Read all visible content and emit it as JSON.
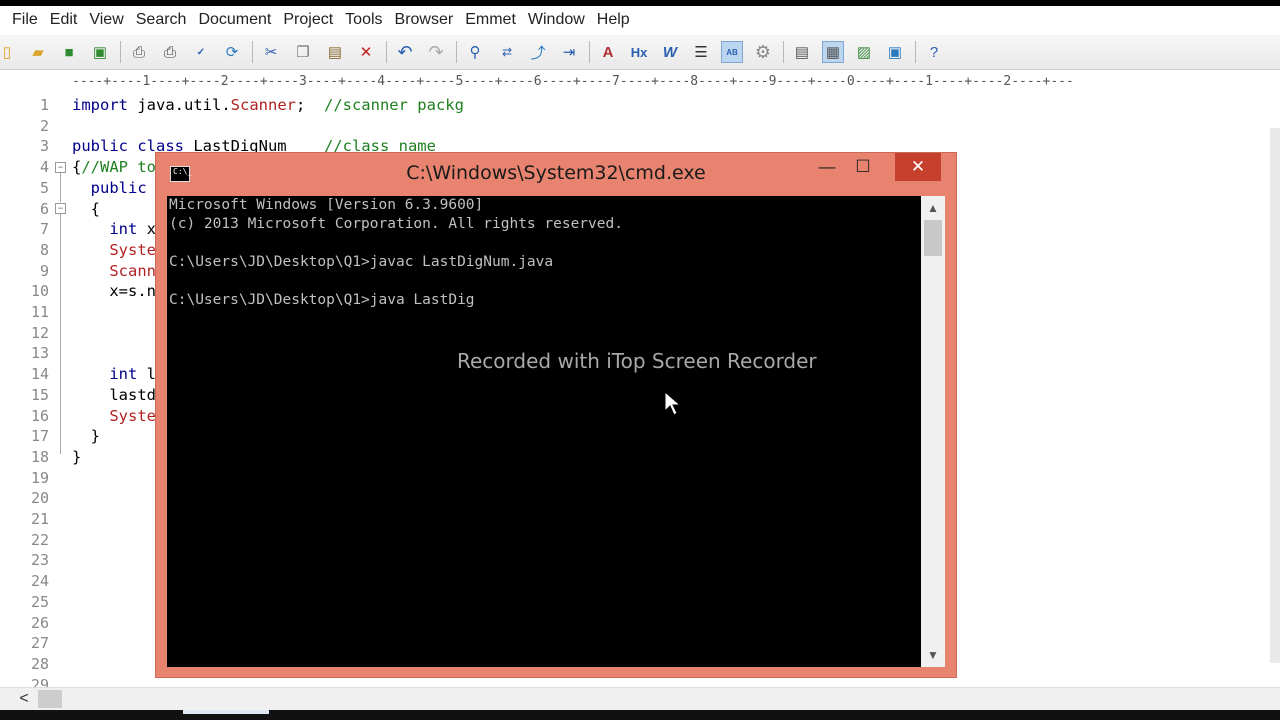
{
  "menu": [
    "File",
    "Edit",
    "View",
    "Search",
    "Document",
    "Project",
    "Tools",
    "Browser",
    "Emmet",
    "Window",
    "Help"
  ],
  "toolbar": {
    "icons": [
      "new-file-icon",
      "open-folder-icon",
      "save-icon",
      "save-all-icon",
      "print-preview-icon",
      "print-icon",
      "spell-check-icon",
      "sync-icon",
      "cut-icon",
      "copy-icon",
      "paste-icon",
      "delete-icon",
      "undo-icon",
      "redo-icon",
      "find-icon",
      "replace-icon",
      "goto-icon",
      "indent-icon",
      "font-icon",
      "hex-icon",
      "word-wrap-icon",
      "align-icon",
      "column-mode-icon",
      "settings-icon",
      "panel-icon",
      "layout-icon",
      "image-icon",
      "export-icon",
      "help-icon"
    ]
  },
  "ruler": "----+----1----+----2----+----3----+----4----+----5----+----6----+----7----+----8----+----9----+----0----+----1----+----2----+---",
  "editor": {
    "line_numbers": [
      "1",
      "2",
      "3",
      "4",
      "5",
      "6",
      "7",
      "8",
      "9",
      "10",
      "11",
      "12",
      "13",
      "14",
      "15",
      "16",
      "17",
      "18",
      "19",
      "20",
      "21",
      "22",
      "23",
      "24",
      "25",
      "26",
      "27",
      "28",
      "29"
    ],
    "code": {
      "l1_kw": "import",
      "l1_text": " java.util.",
      "l1_red": "Scanner",
      "l1_semi": ";  ",
      "l1_cm": "//scanner packg",
      "l3_kw": "public class",
      "l3_text": " LastDigNum    ",
      "l3_cm": "//class name",
      "l4_brace": "{",
      "l4_cm": "//WAP to",
      "l5_kw": "  public",
      "l6_text": "  {",
      "l7_kw": "    int",
      "l7_text": " x",
      "l8_red": "    Syste",
      "l9_red": "    Scann",
      "l10_text": "    x=s.n",
      "l14_kw": "    int",
      "l14_text": " l",
      "l15_text": "    lastd",
      "l16_red": "    Syste",
      "l17_text": "  }",
      "l18_text": "}"
    }
  },
  "cmd": {
    "title": "C:\\Windows\\System32\\cmd.exe",
    "icon_text": "C:\\_",
    "minimize": "—",
    "maximize": "☐",
    "close": "✕",
    "lines": [
      "Microsoft Windows [Version 6.3.9600]",
      "(c) 2013 Microsoft Corporation. All rights reserved.",
      "",
      "C:\\Users\\JD\\Desktop\\Q1>javac LastDigNum.java",
      "",
      "C:\\Users\\JD\\Desktop\\Q1>java LastDig"
    ],
    "watermark": "Recorded with iTop Screen Recorder"
  },
  "hscroll_left": "<"
}
